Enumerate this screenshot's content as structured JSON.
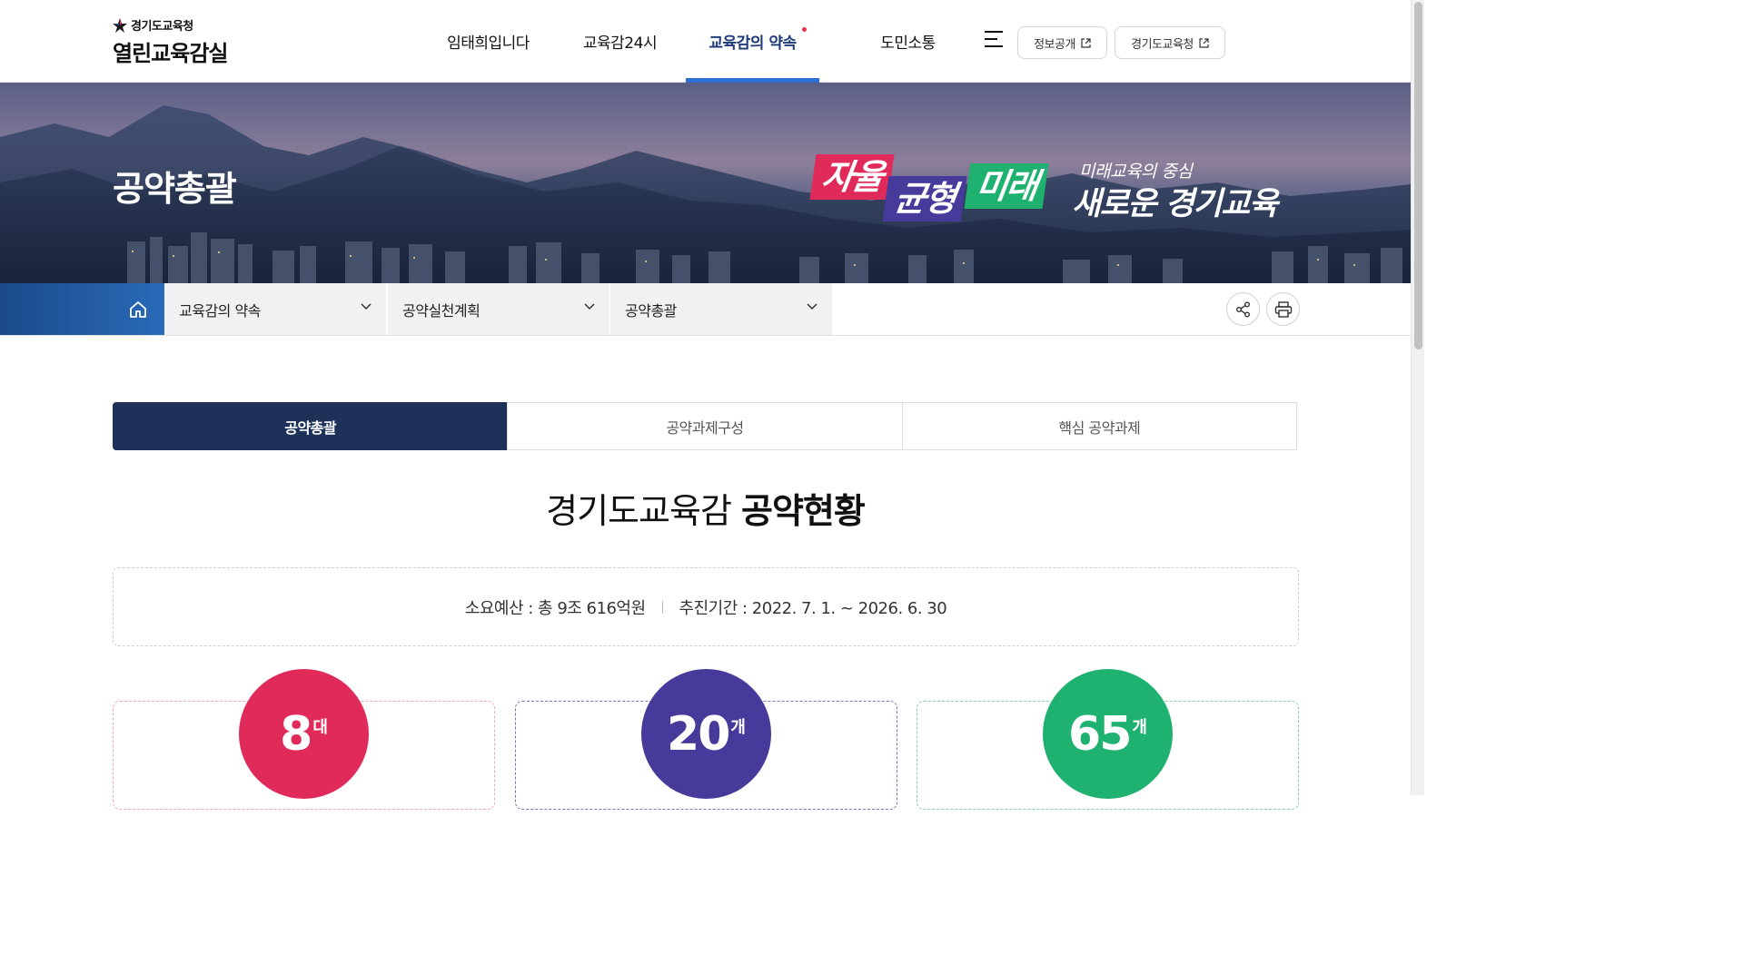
{
  "header": {
    "org_name": "경기도교육청",
    "site_name": "열린교육감실",
    "nav": [
      {
        "label": "임태희입니다",
        "active": false
      },
      {
        "label": "교육감24시",
        "active": false
      },
      {
        "label": "교육감의 약속",
        "active": true
      },
      {
        "label": "도민소통",
        "active": false
      }
    ],
    "menu_icon": "hamburger-icon",
    "external_links": [
      {
        "label": "정보공개",
        "icon": "external-link-icon"
      },
      {
        "label": "경기도교육청",
        "icon": "external-link-icon"
      }
    ]
  },
  "banner": {
    "page_title": "공약총괄",
    "keyword_1": "자율",
    "keyword_2": "균형",
    "keyword_3": "미래",
    "slogan_sub": "미래교육의 중심",
    "slogan_main": "새로운 경기교육"
  },
  "location": {
    "home_icon": "home-icon",
    "depth1": "교육감의 약속",
    "depth2": "공약실천계획",
    "depth3": "공약총괄",
    "share_icon": "share-icon",
    "print_icon": "print-icon"
  },
  "tabs": [
    {
      "label": "공약총괄",
      "active": true
    },
    {
      "label": "공약과제구성",
      "active": false
    },
    {
      "label": "핵심 공약과제",
      "active": false
    }
  ],
  "section": {
    "title_light": "경기도교육감",
    "title_bold": "공약현황"
  },
  "summary": {
    "budget": "소요예산 : 총 9조 616억원",
    "period": "추진기간 : 2022. 7. 1. ~ 2026. 6. 30"
  },
  "stats": [
    {
      "number": "8",
      "unit": "대",
      "color": "#e02a5a"
    },
    {
      "number": "20",
      "unit": "개",
      "color": "#463a9a"
    },
    {
      "number": "65",
      "unit": "개",
      "color": "#1fb170"
    }
  ],
  "colors": {
    "primary_navy": "#1e3159",
    "nav_active_underline": "#2f6fd3",
    "accent_red": "#e02a5a",
    "accent_purple": "#463a9a",
    "accent_green": "#1fb170"
  }
}
